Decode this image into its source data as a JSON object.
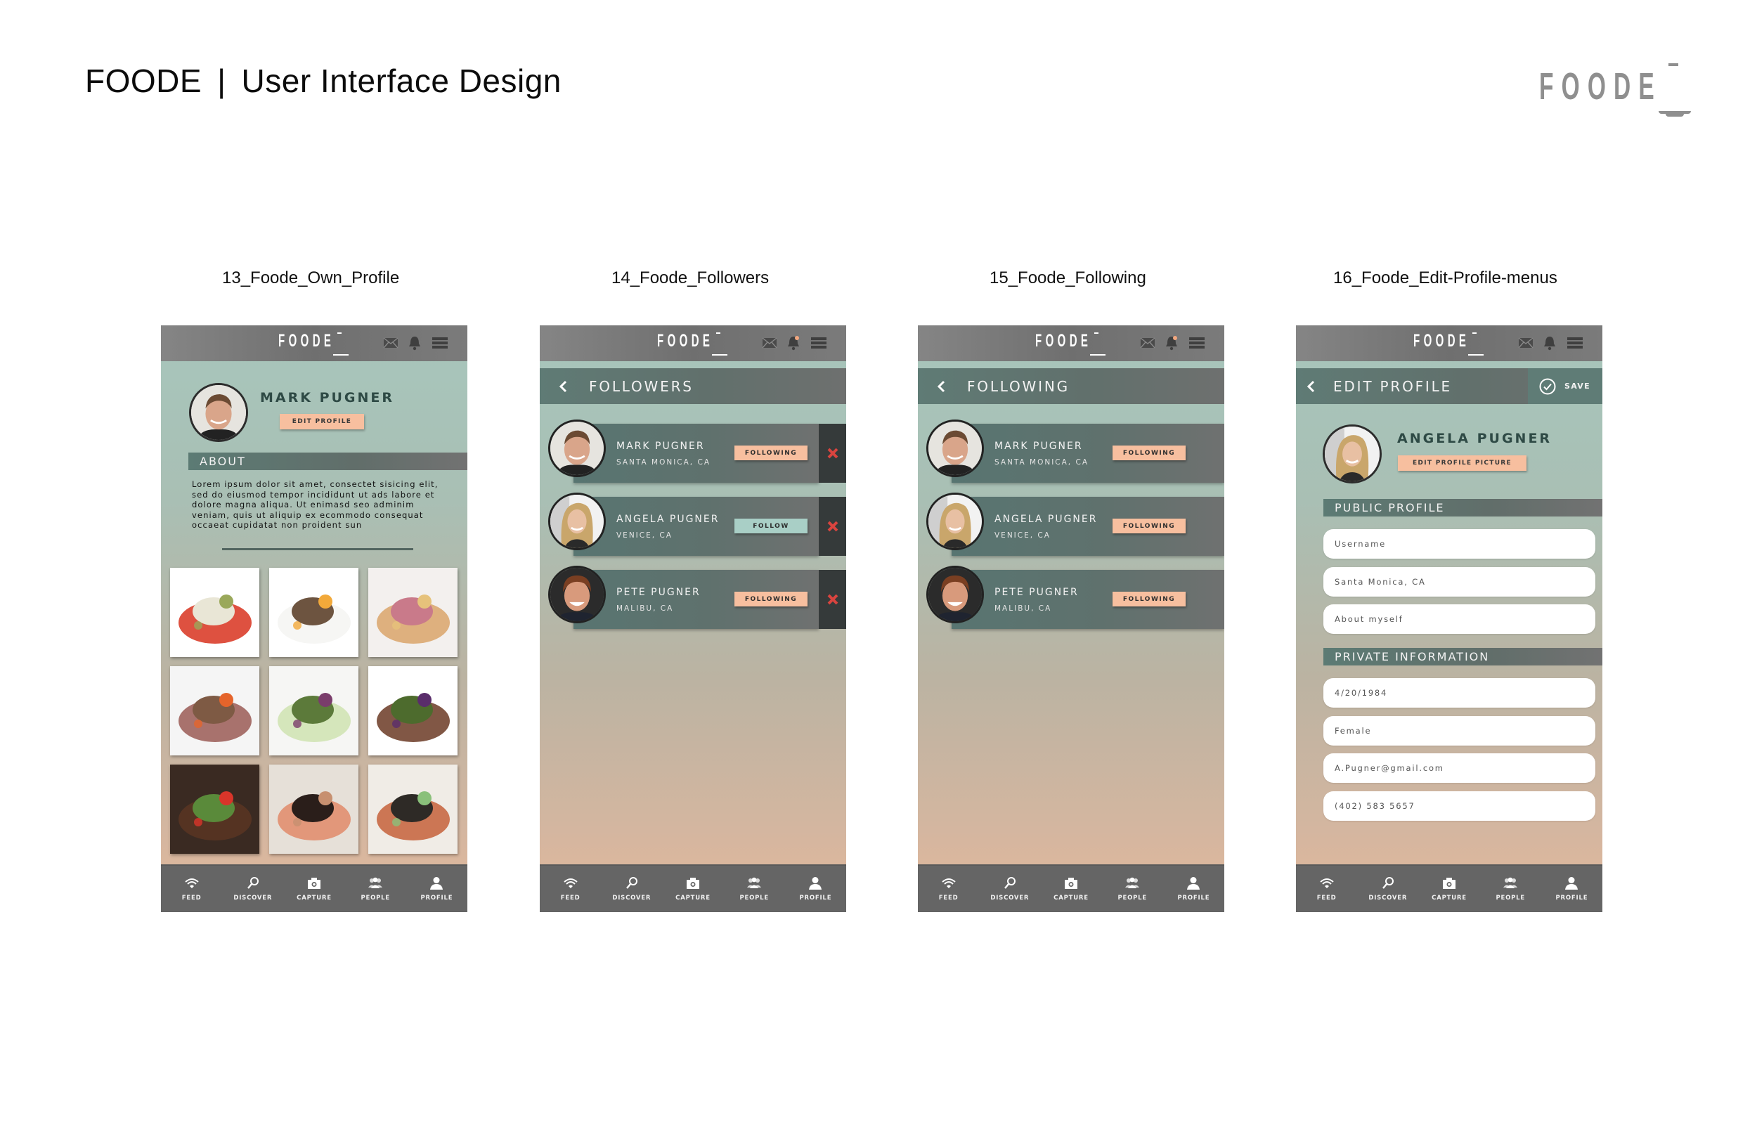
{
  "page": {
    "title_brand": "FOODE",
    "title_separator": "|",
    "title_text": "User Interface Design",
    "logo_text": "FOODE"
  },
  "app": {
    "logo_text": "FOODE",
    "tabs": [
      {
        "label": "FEED",
        "icon": "wifi-icon"
      },
      {
        "label": "DISCOVER",
        "icon": "magnifier-icon"
      },
      {
        "label": "CAPTURE",
        "icon": "camera-icon"
      },
      {
        "label": "PEOPLE",
        "icon": "people-icon"
      },
      {
        "label": "PROFILE",
        "icon": "person-icon"
      }
    ],
    "colors": {
      "accent_peach": "#f7bf9f",
      "accent_mint": "#a9cfc6",
      "header_gray": "#767676",
      "section_teal": "#5f7b75",
      "remove_red": "#d9443f",
      "tabbar_gray": "#656565"
    }
  },
  "screens": [
    {
      "caption": "13_Foode_Own_Profile",
      "bell_notification": false,
      "profile": {
        "name": "MARK PUGNER",
        "edit_button": "EDIT PROFILE",
        "about_heading": "ABOUT",
        "about_text": "Lorem ipsum dolor sit amet, consectet sisicing elit, sed do eiusmod tempor incididunt ut ads labore et dolore magna aliqua. Ut enimasd seo adminim veniam, quis ut aliquip ex ecommodo consequat occaeat cupidatat non proident sun",
        "photos": [
          "fish-on-risotto",
          "plated-bites-with-egg-yolk",
          "corn-dog-platter",
          "rack-of-lamb",
          "cucumber-wrapped-salad",
          "beef-with-edible-flower",
          "steak-with-asparagus",
          "caviar-canapes",
          "glazed-salmon"
        ]
      }
    },
    {
      "caption": "14_Foode_Followers",
      "bell_notification": true,
      "header_title": "FOLLOWERS",
      "rows": [
        {
          "name": "MARK PUGNER",
          "location": "SANTA MONICA, CA",
          "button": "FOLLOWING",
          "state": "following",
          "avatar": "mark"
        },
        {
          "name": "ANGELA PUGNER",
          "location": "VENICE, CA",
          "button": "FOLLOW",
          "state": "follow",
          "avatar": "angela"
        },
        {
          "name": "PETE PUGNER",
          "location": "MALIBU, CA",
          "button": "FOLLOWING",
          "state": "following",
          "avatar": "pete"
        }
      ]
    },
    {
      "caption": "15_Foode_Following",
      "bell_notification": true,
      "header_title": "FOLLOWING",
      "rows": [
        {
          "name": "MARK PUGNER",
          "location": "SANTA MONICA, CA",
          "button": "FOLLOWING",
          "state": "following",
          "avatar": "mark"
        },
        {
          "name": "ANGELA PUGNER",
          "location": "VENICE, CA",
          "button": "FOLLOWING",
          "state": "following",
          "avatar": "angela"
        },
        {
          "name": "PETE PUGNER",
          "location": "MALIBU, CA",
          "button": "FOLLOWING",
          "state": "following",
          "avatar": "pete"
        }
      ]
    },
    {
      "caption": "16_Foode_Edit-Profile-menus",
      "bell_notification": false,
      "header_title": "EDIT PROFILE",
      "save_label": "SAVE",
      "profile": {
        "name": "ANGELA PUGNER",
        "edit_picture_button": "EDIT PROFILE PICTURE"
      },
      "public_heading": "PUBLIC PROFILE",
      "public_fields": [
        {
          "placeholder": "Username",
          "value": ""
        },
        {
          "placeholder": "",
          "value": "Santa Monica, CA"
        },
        {
          "placeholder": "About myself",
          "value": ""
        }
      ],
      "private_heading": "PRIVATE INFORMATION",
      "private_fields": [
        {
          "placeholder": "",
          "value": "4/20/1984"
        },
        {
          "placeholder": "",
          "value": "Female"
        },
        {
          "placeholder": "",
          "value": "A.Pugner@gmail.com"
        },
        {
          "placeholder": "",
          "value": "(402) 583 5657"
        }
      ]
    }
  ]
}
